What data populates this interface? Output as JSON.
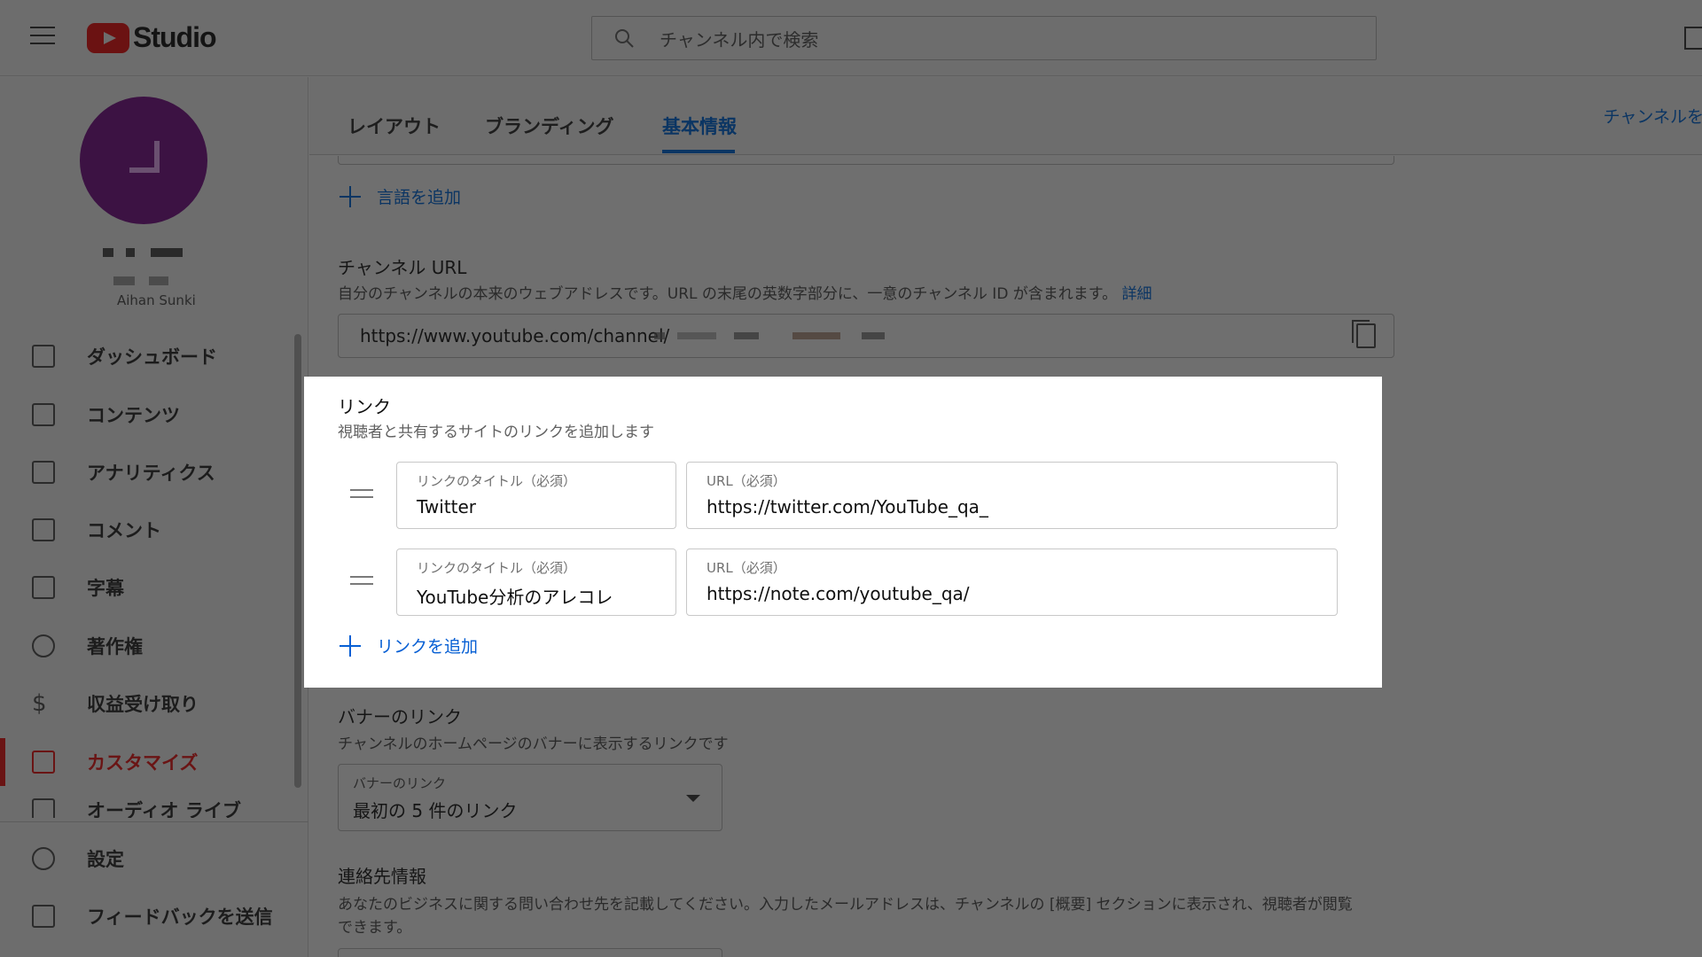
{
  "header": {
    "logo_text": "Studio",
    "search_placeholder": "チャンネル内で検索"
  },
  "sidebar": {
    "channel_name": "Aihan Sunki",
    "items": [
      {
        "label": "ダッシュボード",
        "icon": "dashboard-icon"
      },
      {
        "label": "コンテンツ",
        "icon": "content-icon"
      },
      {
        "label": "アナリティクス",
        "icon": "analytics-icon"
      },
      {
        "label": "コメント",
        "icon": "comment-icon"
      },
      {
        "label": "字幕",
        "icon": "subtitles-icon"
      },
      {
        "label": "著作権",
        "icon": "copyright-icon"
      },
      {
        "label": "収益受け取り",
        "icon": "dollar-icon"
      },
      {
        "label": "カスタマイズ",
        "icon": "magic-wand-icon",
        "active": true
      },
      {
        "label": "オーディオ ライブ",
        "icon": "audio-library-icon"
      },
      {
        "label": "設定",
        "icon": "gear-icon"
      },
      {
        "label": "フィードバックを送信",
        "icon": "feedback-icon"
      }
    ]
  },
  "tabs": {
    "layout": "レイアウト",
    "branding": "ブランディング",
    "basic_info": "基本情報",
    "view_channel": "チャンネルを表示"
  },
  "main": {
    "add_language": "言語を追加",
    "channel_url": {
      "title": "チャンネル URL",
      "desc": "自分のチャンネルの本来のウェブアドレスです。URL の末尾の英数字部分に、一意のチャンネル ID が含まれます。",
      "desc_link": "詳細",
      "value": "https://www.youtube.com/channel/"
    },
    "banner_links": {
      "title": "バナーのリンク",
      "desc": "チャンネルのホームページのバナーに表示するリンクです",
      "select_label": "バナーのリンク",
      "select_value": "最初の 5 件のリンク"
    },
    "contact": {
      "title": "連絡先情報",
      "desc_line1": "あなたのビジネスに関する問い合わせ先を記載してください。入力したメールアドレスは、チャンネルの [概要] セクションに表示され、視聴者が閲覧",
      "desc_line2": "できます。"
    }
  },
  "links_card": {
    "title": "リンク",
    "desc": "視聴者と共有するサイトのリンクを追加します",
    "title_label": "リンクのタイトル（必須）",
    "url_label": "URL（必須）",
    "rows": [
      {
        "title": "Twitter",
        "url": "https://twitter.com/YouTube_qa_"
      },
      {
        "title": "YouTube分析のアレコレ",
        "url": "https://note.com/youtube_qa/"
      }
    ],
    "add_link": "リンクを追加"
  }
}
